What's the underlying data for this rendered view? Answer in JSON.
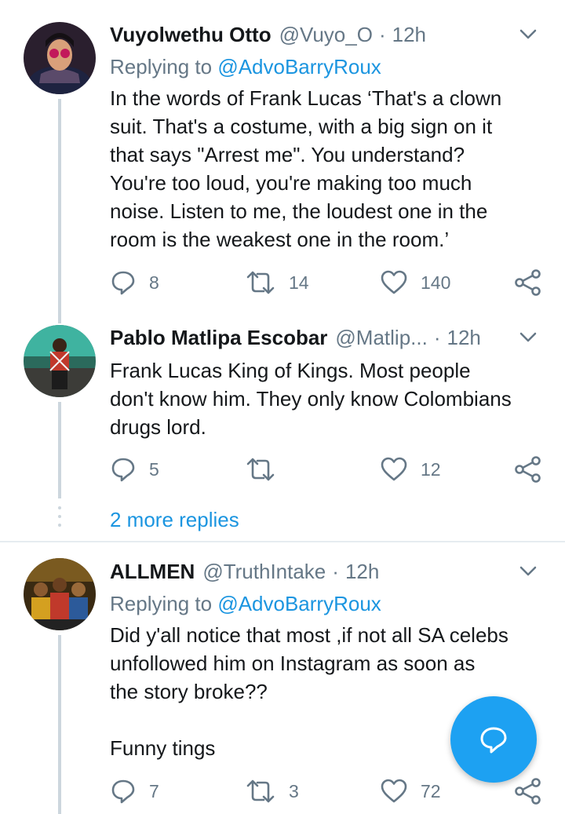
{
  "tweets": [
    {
      "name": "Vuyolwethu Otto",
      "handle": "@Vuyo_O",
      "time": "12h",
      "replying_label": "Replying to",
      "replying_to": "@AdvoBarryRoux",
      "text": "In the words of Frank Lucas ‘That's a clown\nsuit. That's a costume, with a big sign on it\nthat says \"Arrest me\". You understand?\nYou're too loud, you're making too much\nnoise. Listen to me, the loudest one in the\nroom is the weakest one in the room.’",
      "replies": "8",
      "retweets": "14",
      "likes": "140"
    },
    {
      "name": "Pablo Matlipa Escobar",
      "handle": "@Matlip...",
      "time": "12h",
      "text": "Frank Lucas King of Kings. Most people\ndon't know him. They only know Colombians\ndrugs lord.",
      "replies": "5",
      "retweets": "",
      "likes": "12"
    },
    {
      "name": "ALLMEN",
      "handle": "@TruthIntake",
      "time": "12h",
      "replying_label": "Replying to",
      "replying_to": "@AdvoBarryRoux",
      "text": "Did y'all notice that most ,if not all SA celebs\nunfollowed him on Instagram as soon as\nthe story broke??\n\nFunny tings",
      "replies": "7",
      "retweets": "3",
      "likes": "72"
    }
  ],
  "more_replies": "2 more replies",
  "separator": "·",
  "colors": {
    "accent": "#1da1f2",
    "link": "#1b95e0",
    "muted": "#657786",
    "line": "#ccd6dd"
  },
  "icons": {
    "reply": "reply-icon",
    "retweet": "retweet-icon",
    "like": "heart-icon",
    "share": "share-icon",
    "menu": "chevron-down-icon",
    "compose": "compose-reply-icon"
  }
}
